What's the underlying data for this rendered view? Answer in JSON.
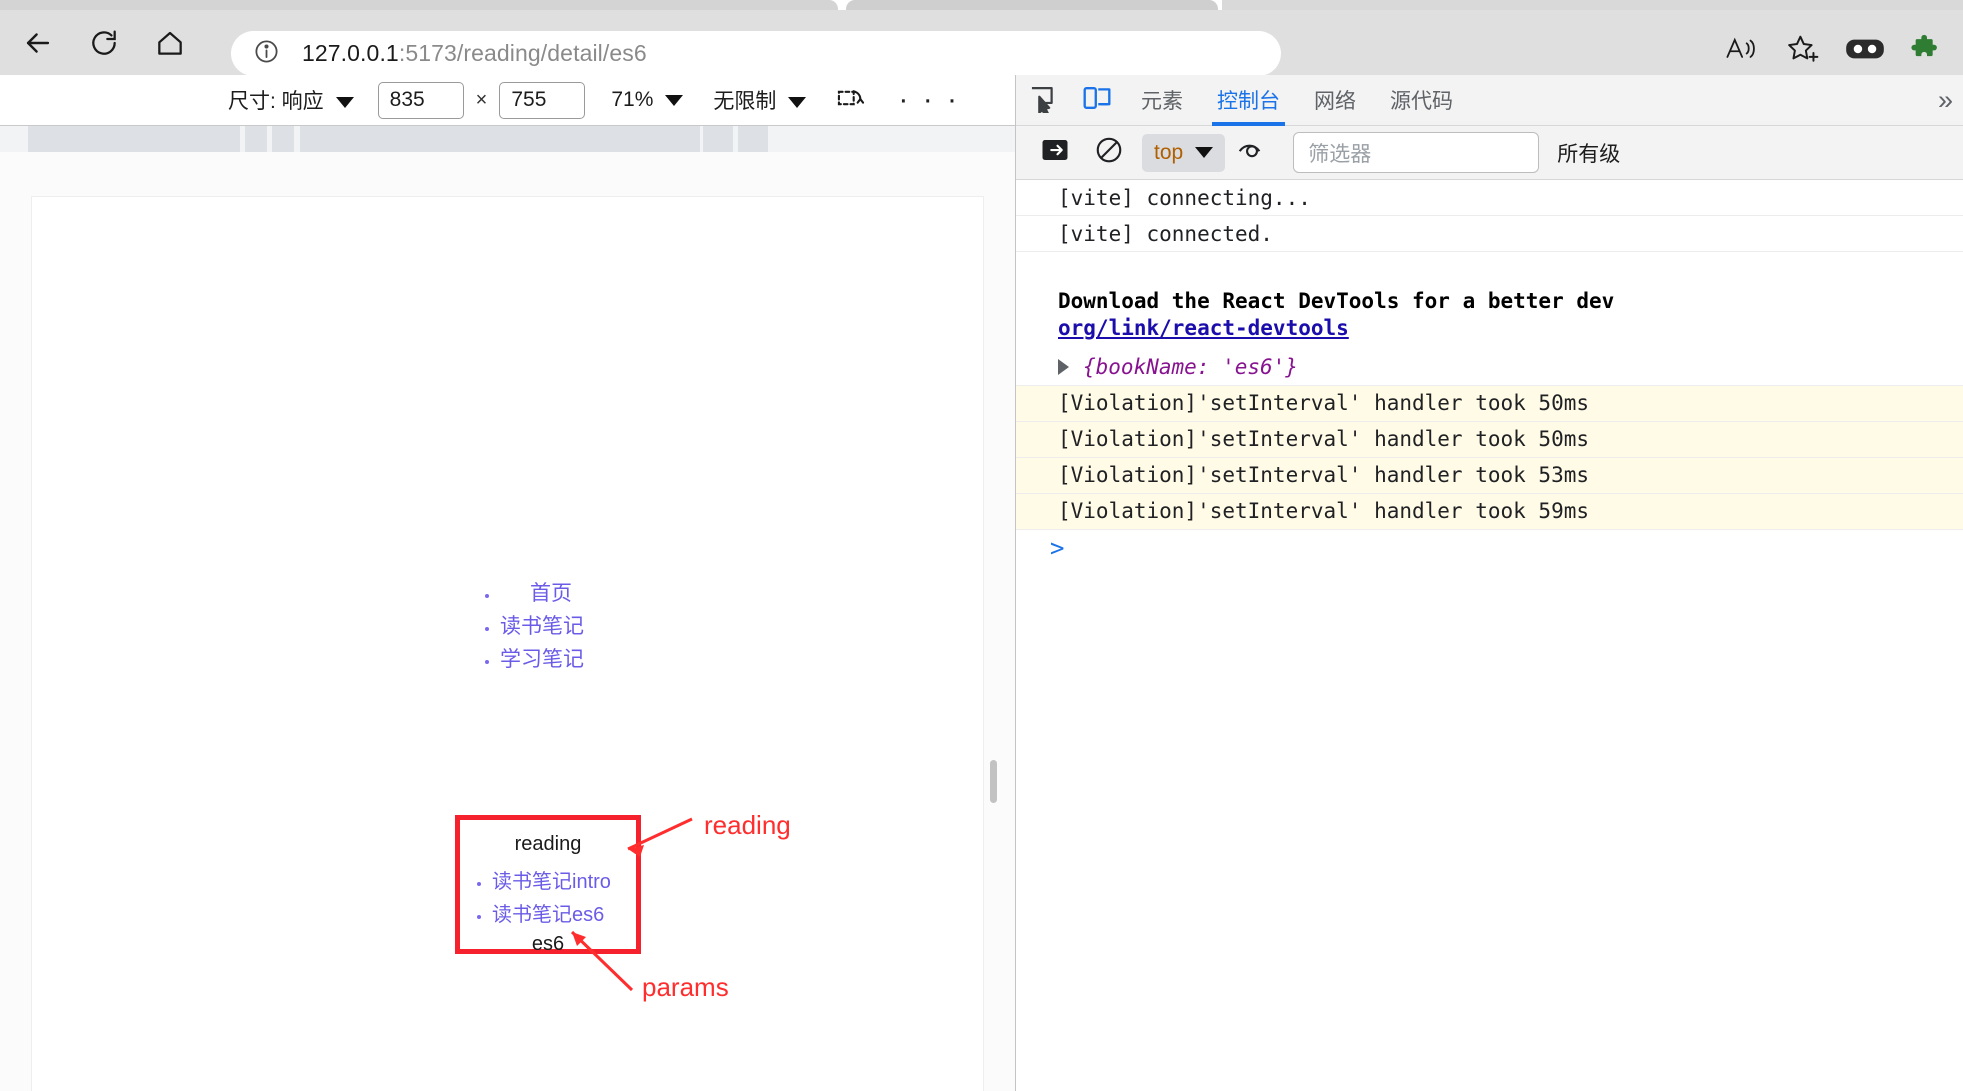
{
  "browser": {
    "url_host": "127.0.0.1",
    "url_rest": ":5173/reading/detail/es6",
    "back_icon": "back-arrow-icon",
    "reload_icon": "reload-icon",
    "home_icon": "home-icon",
    "info_icon": "info-circle-icon",
    "read_aloud_icon": "read-aloud-icon",
    "favorite_icon": "favorite-star-icon",
    "collections_icon": "collections-icon",
    "extensions_icon": "extensions-puzzle-icon"
  },
  "device_toolbar": {
    "size_label": "尺寸: 响应",
    "width": "835",
    "separator": "×",
    "height": "755",
    "zoom": "71%",
    "throttle": "无限制",
    "screenshot_icon": "rotate-screenshot-icon",
    "more_icon": "more-options-icon"
  },
  "page": {
    "nav_links": [
      {
        "label": "首页"
      },
      {
        "label": "读书笔记"
      },
      {
        "label": "学习笔记"
      }
    ],
    "reading_box": {
      "title": "reading",
      "links": [
        {
          "label": "读书笔记intro"
        },
        {
          "label": "读书笔记es6"
        }
      ],
      "param": "es6"
    },
    "annotations": [
      {
        "text": "reading"
      },
      {
        "text": "params"
      }
    ],
    "annotation_color": "#ff2d2d",
    "link_color": "#6b5ce8"
  },
  "devtools": {
    "inspect_icon": "inspect-element-icon",
    "device_toggle_icon": "device-toolbar-icon",
    "tabs": [
      {
        "label": "元素",
        "active": false
      },
      {
        "label": "控制台",
        "active": true
      },
      {
        "label": "网络",
        "active": false
      },
      {
        "label": "源代码",
        "active": false
      }
    ],
    "more_tabs_icon": "chevron-double-right-icon",
    "console_toolbar": {
      "sidebar_icon": "console-sidebar-icon",
      "clear_icon": "clear-console-icon",
      "context": "top",
      "eye_icon": "live-expression-icon",
      "filter_placeholder": "筛选器",
      "levels_label": "所有级"
    },
    "console_messages": [
      {
        "type": "log",
        "text": "[vite] connecting..."
      },
      {
        "type": "log",
        "text": "[vite] connected."
      },
      {
        "type": "react",
        "line1": "Download the React DevTools for a better dev",
        "line2": "org/link/react-devtools"
      },
      {
        "type": "object",
        "text": "{bookName: 'es6'}"
      },
      {
        "type": "violation",
        "text": "[Violation]'setInterval' handler took 50ms"
      },
      {
        "type": "violation",
        "text": "[Violation]'setInterval' handler took 50ms"
      },
      {
        "type": "violation",
        "text": "[Violation]'setInterval' handler took 53ms"
      },
      {
        "type": "violation",
        "text": "[Violation]'setInterval' handler took 59ms"
      }
    ],
    "prompt_symbol": ">"
  }
}
